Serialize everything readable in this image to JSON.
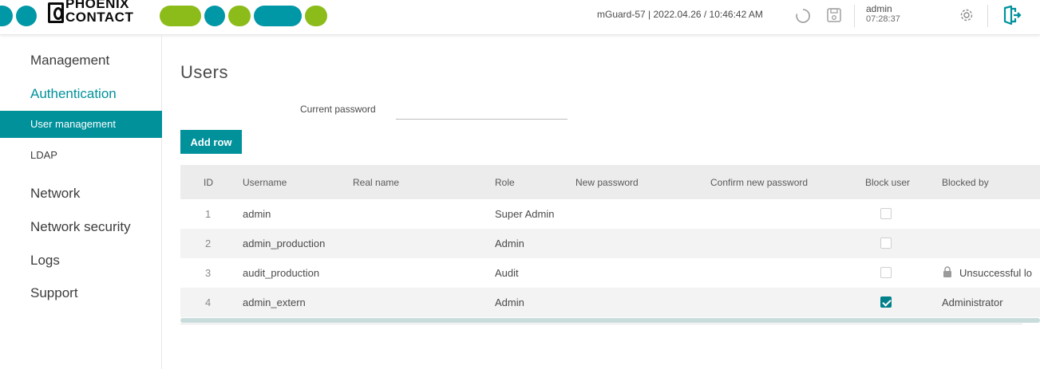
{
  "brand": {
    "logo_line1": "PHOENIX",
    "logo_line2": "CONTACT",
    "green": "#8cbc1a",
    "teal": "#0097a7",
    "accent": "#00919b"
  },
  "header": {
    "device_info": "mGuard-57 | 2022.04.26 / 10:46:42 AM",
    "user_name": "admin",
    "session_time": "07:28:37",
    "icons": [
      "refresh-icon",
      "save-icon",
      "gear-icon",
      "logout-icon"
    ]
  },
  "sidebar": {
    "items": [
      {
        "label": "Management"
      },
      {
        "label": "Authentication"
      },
      {
        "label": "User management"
      },
      {
        "label": "LDAP"
      },
      {
        "label": "Network"
      },
      {
        "label": "Network security"
      },
      {
        "label": "Logs"
      },
      {
        "label": "Support"
      }
    ]
  },
  "main": {
    "title": "Users",
    "current_password_label": "Current password",
    "current_password_value": "",
    "add_row_label": "Add row",
    "columns": [
      "ID",
      "Username",
      "Real name",
      "Role",
      "New password",
      "Confirm new password",
      "Block user",
      "Blocked by"
    ],
    "rows": [
      {
        "id": "1",
        "username": "admin",
        "real_name": "",
        "role": "Super Admin",
        "blocked": false,
        "blocked_by": ""
      },
      {
        "id": "2",
        "username": "admin_production",
        "real_name": "",
        "role": "Admin",
        "blocked": false,
        "blocked_by": ""
      },
      {
        "id": "3",
        "username": "audit_production",
        "real_name": "",
        "role": "Audit",
        "blocked": false,
        "blocked_by": "Unsuccessful lo"
      },
      {
        "id": "4",
        "username": "admin_extern",
        "real_name": "",
        "role": "Admin",
        "blocked": true,
        "blocked_by": "Administrator"
      }
    ]
  }
}
